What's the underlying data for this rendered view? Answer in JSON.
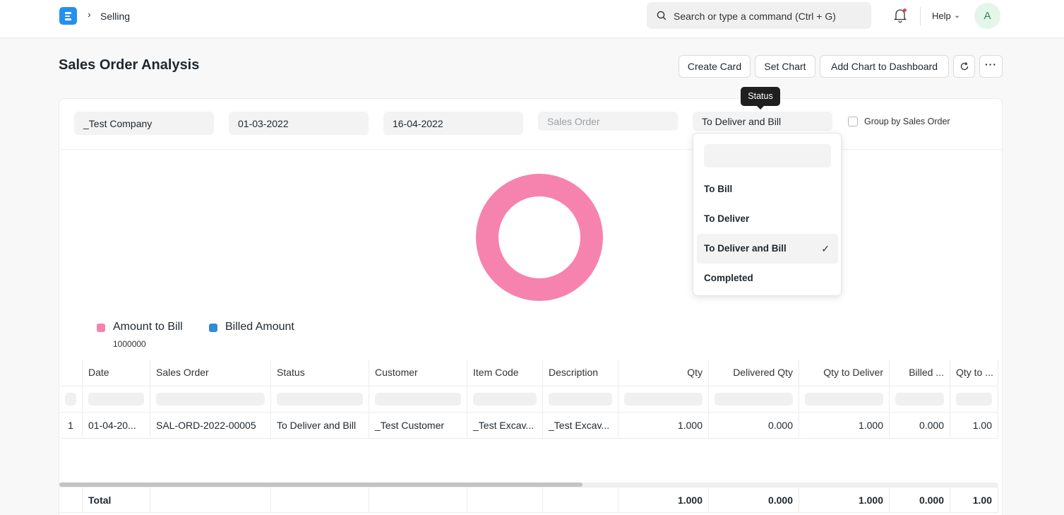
{
  "navbar": {
    "breadcrumb": "Selling",
    "search_placeholder": "Search or type a command (Ctrl + G)",
    "help_label": "Help",
    "avatar_initial": "A"
  },
  "page": {
    "title": "Sales Order Analysis",
    "buttons": {
      "create_card": "Create Card",
      "set_chart": "Set Chart",
      "add_chart": "Add Chart to Dashboard",
      "more": "···"
    }
  },
  "filters": {
    "company": "_Test Company",
    "from_date": "01-03-2022",
    "to_date": "16-04-2022",
    "sales_order_placeholder": "Sales Order",
    "status": "To Deliver and Bill",
    "group_by_label": "Group by Sales Order"
  },
  "tooltip": "Status",
  "status_dropdown": {
    "options": [
      "To Bill",
      "To Deliver",
      "To Deliver and Bill",
      "Completed"
    ],
    "selected": "To Deliver and Bill",
    "check_mark": "✓"
  },
  "chart_data": {
    "type": "pie",
    "style": "donut",
    "series": [
      {
        "name": "Amount to Bill",
        "value": 1000000,
        "color": "#f683ae"
      },
      {
        "name": "Billed Amount",
        "value": 0,
        "color": "#318ad8"
      }
    ],
    "legend_value": "1000000"
  },
  "table": {
    "columns": [
      "",
      "Date",
      "Sales Order",
      "Status",
      "Customer",
      "Item Code",
      "Description",
      "Qty",
      "Delivered Qty",
      "Qty to Deliver",
      "Billed ...",
      "Qty to ..."
    ],
    "rows": [
      [
        "1",
        "01-04-20...",
        "SAL-ORD-2022-00005",
        "To Deliver and Bill",
        "_Test Customer",
        "_Test Excav...",
        "_Test Excav...",
        "1.000",
        "0.000",
        "1.000",
        "0.000",
        "1.00"
      ]
    ],
    "total": [
      "",
      "Total",
      "",
      "",
      "",
      "",
      "",
      "1.000",
      "0.000",
      "1.000",
      "0.000",
      "1.00"
    ]
  },
  "colors": {
    "brand": "#2490ef",
    "amount_to_bill": "#f683ae",
    "billed_amount": "#318ad8"
  }
}
